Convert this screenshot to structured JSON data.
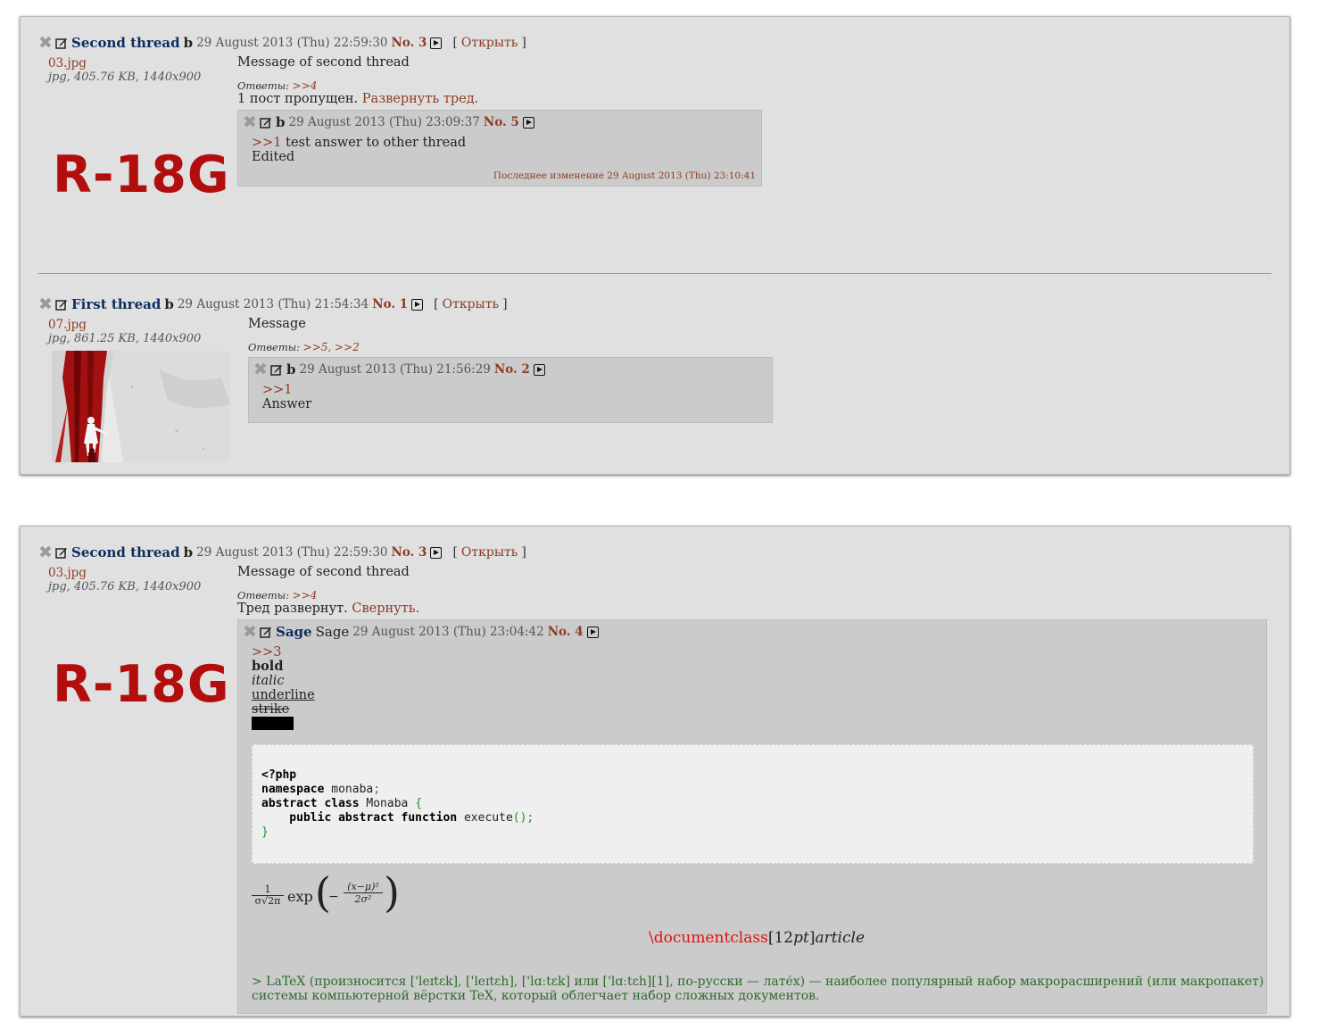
{
  "panel1": {
    "thread_a": {
      "subject": "Second thread",
      "name": "b",
      "date": "29 August 2013 (Thu) 22:59:30",
      "no": "No. 3",
      "bracket_open": "[",
      "open_link": "Открыть",
      "bracket_close": "]",
      "file_name": "03.jpg",
      "file_info": "jpg, 405.76 KB, 1440x900",
      "rating_badge": "R-18G",
      "message": "Message of second thread",
      "replies_label": "Ответы:",
      "replies_links": ">>4",
      "omitted_text": "1 пост пропущен.",
      "expand_link": "Развернуть тред.",
      "reply": {
        "name": "b",
        "date": "29 August 2013 (Thu) 23:09:37",
        "no": "No. 5",
        "quote_link": ">>1",
        "text_after_link": " test answer to other thread",
        "line2": "Edited",
        "edited_note": "Последнее изменение 29 August 2013 (Thu) 23:10:41"
      }
    },
    "thread_b": {
      "subject": "First thread",
      "name": "b",
      "date": "29 August 2013 (Thu) 21:54:34",
      "no": "No. 1",
      "bracket_open": "[",
      "open_link": "Открыть",
      "bracket_close": "]",
      "file_name": "07.jpg",
      "file_info": "jpg, 861.25 KB, 1440x900",
      "message": "Message",
      "replies_label": "Ответы:",
      "replies_links": ">>5, >>2",
      "reply": {
        "name": "b",
        "date": "29 August 2013 (Thu) 21:56:29",
        "no": "No. 2",
        "quote_link": ">>1",
        "line2": "Answer"
      }
    }
  },
  "panel2": {
    "subject": "Second thread",
    "name": "b",
    "date": "29 August 2013 (Thu) 22:59:30",
    "no": "No. 3",
    "bracket_open": "[",
    "open_link": "Открыть",
    "bracket_close": "]",
    "file_name": "03.jpg",
    "file_info": "jpg, 405.76 KB, 1440x900",
    "rating_badge": "R-18G",
    "message": "Message of second thread",
    "replies_label": "Ответы:",
    "replies_links": ">>4",
    "expanded_text": "Тред развернут.",
    "collapse_link": "Свернуть.",
    "reply": {
      "subject": "Sage",
      "name": "Sage",
      "date": "29 August 2013 (Thu) 23:04:42",
      "no": "No. 4",
      "quote_link": ">>3",
      "bold": "bold",
      "italic": "italic",
      "underline": "underline",
      "strike": "strike",
      "code": {
        "line1": "<?php",
        "line2_kw": "namespace",
        "line2_rest": " monaba",
        "line2_end": ";",
        "line3_kw": "abstract class",
        "line3_rest": " Monaba ",
        "line3_end": "{",
        "line4_kw": "    public abstract function",
        "line4_rest": " execute",
        "line4_end": "();",
        "line5": "}"
      },
      "formula": {
        "num": "1",
        "den": "σ√2π",
        "exp": "exp",
        "minus": "−",
        "num2": "(x−μ)²",
        "den2": "2σ²"
      },
      "tex_cmd": "\\documentclass",
      "tex_arg1": "[12",
      "tex_arg1_it": "pt",
      "tex_arg2": "]",
      "tex_arg2_it": "article",
      "quote_line1": "> LaTeX (произносится ['leɪtɛk], ['leɪtɛh], ['lɑːtɛk] или ['lɑːtɛh][1], по-русски — лате́х) — наиболее популярный набор макрорасширений (или макропакет)",
      "quote_line2": "системы компьютерной вёрстки TeX, который облегчает набор сложных документов."
    }
  },
  "icons": {
    "delete": "✖",
    "edit": "edit-icon",
    "play": "play-icon"
  },
  "colors": {
    "link": "#8d3b22",
    "subject": "#0e2d5f",
    "badge": "#b20e0e",
    "panel_bg": "#e0e0e0",
    "reply_bg": "#cbcbcb"
  }
}
